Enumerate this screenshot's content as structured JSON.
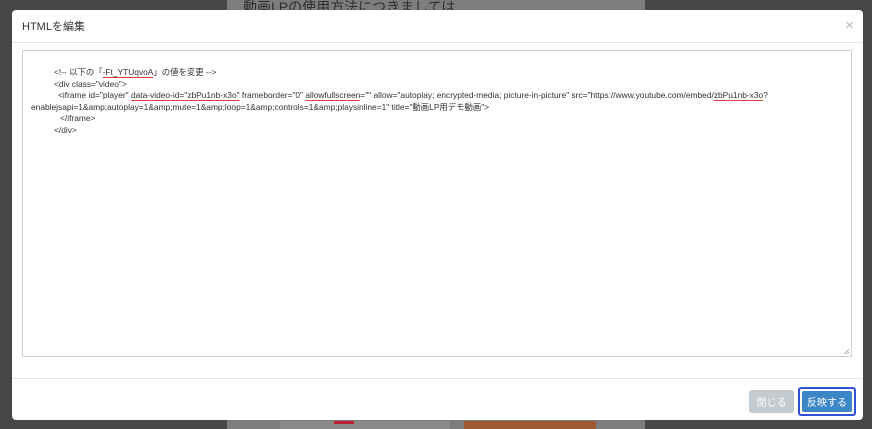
{
  "background": {
    "heading": "動画LPの使用方法につきましては"
  },
  "modal": {
    "title": "HTMLを編集",
    "close_symbol": "×",
    "code": {
      "line1_prefix": "<!-- 以下の「",
      "line1_id": "-Ft_YTUqvoA",
      "line1_suffix": "」の値を変更 -->",
      "line2": "<div class=\"video\">",
      "line3_a": "<iframe id=\"player\" ",
      "line3_attr1": "data-video-id=\"zbPu1nb-x3o\"",
      "line3_b": " frameborder=\"0\" ",
      "line3_attr2": "allowfullscreen",
      "line3_c": "=\"\" allow=\"autoplay; encrypted-media; picture-in-picture\" src=\"https://www.youtube.com/embed/",
      "line3_attr3": "zbPu1nb-x3o",
      "line3_d": "?",
      "line4": "enablejsapi=1&amp;autoplay=1&amp;mute=1&amp;loop=1&amp;controls=1&amp;playsinline=1\" title=\"動画LP用デモ動画\">",
      "line5": "</iframe>",
      "line6": "</div>"
    },
    "footer": {
      "close_label": "閉じる",
      "apply_label": "反映する"
    }
  },
  "colors": {
    "primary": "#3d86c6",
    "secondary_disabled": "#c3cbd1",
    "focus_ring": "#2e4fd6",
    "spellcheck_underline": "#d9453a"
  }
}
